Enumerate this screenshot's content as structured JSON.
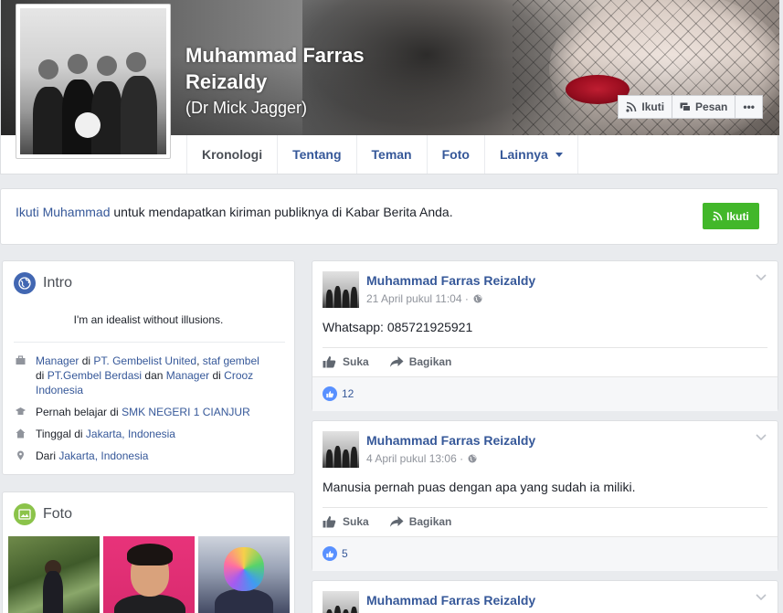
{
  "profile": {
    "name": "Muhammad Farras Reizaldy",
    "alternate_name": "(Dr Mick Jagger)"
  },
  "cover_actions": {
    "follow": "Ikuti",
    "message": "Pesan",
    "more": "•••"
  },
  "tabs": [
    {
      "label": "Kronologi",
      "active": true
    },
    {
      "label": "Tentang"
    },
    {
      "label": "Teman"
    },
    {
      "label": "Foto"
    },
    {
      "label": "Lainnya"
    }
  ],
  "follow_banner": {
    "link": "Ikuti Muhammad",
    "text": " untuk mendapatkan kiriman publiknya di Kabar Berita Anda.",
    "button": "Ikuti"
  },
  "intro": {
    "title": "Intro",
    "bio": "I'm an idealist without illusions.",
    "work": {
      "p1": "Manager",
      "t1": " di ",
      "p2": "PT. Gembelist United",
      "t2": ", ",
      "p3": "staf gembel",
      "t3": "di ",
      "p4": "PT.Gembel Berdasi",
      "t4": " dan ",
      "p5": "Manager",
      "t5": " di ",
      "p6": "Crooz Indonesia"
    },
    "education": {
      "text": "Pernah belajar di ",
      "link": "SMK NEGERI 1 CIANJUR"
    },
    "lives": {
      "text": "Tinggal di ",
      "link": "Jakarta, Indonesia"
    },
    "from": {
      "text": "Dari ",
      "link": "Jakarta, Indonesia"
    }
  },
  "photos": {
    "title": "Foto"
  },
  "posts": [
    {
      "author": "Muhammad Farras Reizaldy",
      "date": "21 April pukul 11:04 ·",
      "text": "Whatsapp: 085721925921",
      "likes": "12"
    },
    {
      "author": "Muhammad Farras Reizaldy",
      "date": "4 April pukul 13:06 ·",
      "text": "Manusia pernah puas dengan apa yang sudah ia miliki.",
      "likes": "5"
    },
    {
      "author": "Muhammad Farras Reizaldy"
    }
  ],
  "post_actions": {
    "like": "Suka",
    "share": "Bagikan"
  },
  "colors": {
    "link": "#365899",
    "green_button": "#42b72a",
    "background": "#e9ebee"
  }
}
